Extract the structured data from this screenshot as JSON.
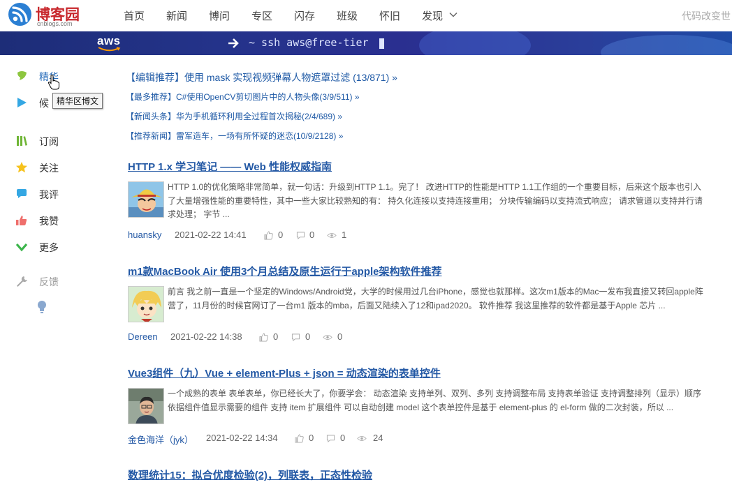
{
  "header": {
    "logo_name": "博客园",
    "logo_sub": "cnblogs.com",
    "nav": [
      "首页",
      "新闻",
      "博问",
      "专区",
      "闪存",
      "班级",
      "怀旧",
      "发现"
    ],
    "right_text": "代码改变世"
  },
  "banner": {
    "brand": "aws",
    "command": "~ ssh aws@free-tier"
  },
  "sidebar": {
    "items": [
      {
        "label": "精华",
        "icon": "diamond-icon"
      },
      {
        "label": "候",
        "icon": "play-icon"
      },
      {
        "label": "订阅",
        "icon": "books-icon"
      },
      {
        "label": "关注",
        "icon": "star-icon"
      },
      {
        "label": "我评",
        "icon": "comment-icon"
      },
      {
        "label": "我赞",
        "icon": "thumbs-up-icon"
      },
      {
        "label": "更多",
        "icon": "chevron-down-icon"
      },
      {
        "label": "反馈",
        "icon": "wrench-icon"
      }
    ],
    "tooltip": "精华区博文"
  },
  "recommendations": [
    "【编辑推荐】使用 mask 实现视频弹幕人物遮罩过滤 (13/871) »",
    "【最多推荐】C#使用OpenCV剪切图片中的人物头像(3/9/511) »",
    "【新闻头条】华为手机循环利用全过程首次揭秘(2/4/689) »",
    "【推荐新闻】雷军造车，一场有所怀疑的迷恋(10/9/2128) »"
  ],
  "posts": [
    {
      "title": "HTTP 1.x 学习笔记 —— Web 性能权威指南",
      "summary": "HTTP 1.0的优化策略非常简单，就一句话：升级到HTTP 1.1。完了！ 改进HTTP的性能是HTTP 1.1工作组的一个重要目标，后来这个版本也引入了大量增强性能的重要特性，其中一些大家比较熟知的有： 持久化连接以支持连接重用； 分块传输编码以支持流式响应； 请求管道以支持并行请求处理； 字节 ...",
      "author": "huansky",
      "date": "2021-02-22 14:41",
      "likes": "0",
      "comments": "0",
      "views": "1"
    },
    {
      "title": "m1款MacBook Air 使用3个月总结及原生运行于apple架构软件推荐",
      "summary": "前言 我之前一直是一个坚定的Windows/Android党，大学的时候用过几台iPhone，感觉也就那样。这次m1版本的Mac一发布我直接又转回apple阵营了，11月份的时候官网订了一台m1 版本的mba，后面又陆续入了12和ipad2020。 软件推荐 我这里推荐的软件都是基于Apple 芯片 ...",
      "author": "Dereen",
      "date": "2021-02-22 14:38",
      "likes": "0",
      "comments": "0",
      "views": "0"
    },
    {
      "title": "Vue3组件（九）Vue + element-Plus + json = 动态渲染的表单控件",
      "summary": "一个成熟的表单 表单表单，你已经长大了，你要学会： 动态渲染 支持单列、双列、多列 支持调整布局 支持表单验证 支持调整排列（显示）顺序 依据组件值显示需要的组件 支持 item 扩展组件 可以自动创建 model 这个表单控件是基于 element-plus 的 el-form 做的二次封装，所以 ...",
      "author": "金色海洋（jyk）",
      "date": "2021-02-22 14:34",
      "likes": "0",
      "comments": "0",
      "views": "24"
    },
    {
      "title": "数理统计15：拟合优度检验(2)，列联表，正态性检验"
    }
  ]
}
